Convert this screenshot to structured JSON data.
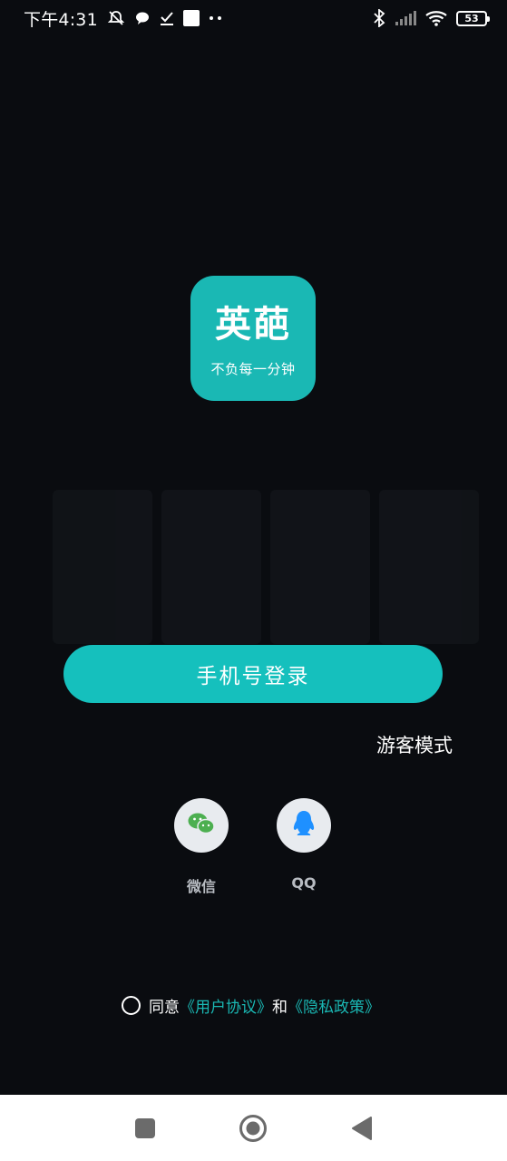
{
  "status_bar": {
    "time": "下午4:31",
    "battery": "53",
    "icons": [
      "mute-bell-icon",
      "chat-bubble-icon",
      "download-done-icon",
      "square-notification-icon",
      "more-dots-icon",
      "bluetooth-icon",
      "signal-icon",
      "wifi-icon",
      "battery-icon"
    ]
  },
  "logo": {
    "title": "英葩",
    "slogan": "不负每一分钟",
    "color": "#1ab8b4"
  },
  "login": {
    "phone_button": "手机号登录",
    "guest_mode": "游客模式"
  },
  "social": {
    "wechat_label": "微信",
    "qq_label": "QQ"
  },
  "agreement": {
    "prefix": "同意",
    "user_agreement": "《用户协议》",
    "connector": "和",
    "privacy_policy": "《隐私政策》"
  },
  "nav": {
    "icons": [
      "recent-apps-icon",
      "home-icon",
      "back-icon"
    ]
  },
  "colors": {
    "background": "#0a0c10",
    "accent": "#15c0bd"
  }
}
